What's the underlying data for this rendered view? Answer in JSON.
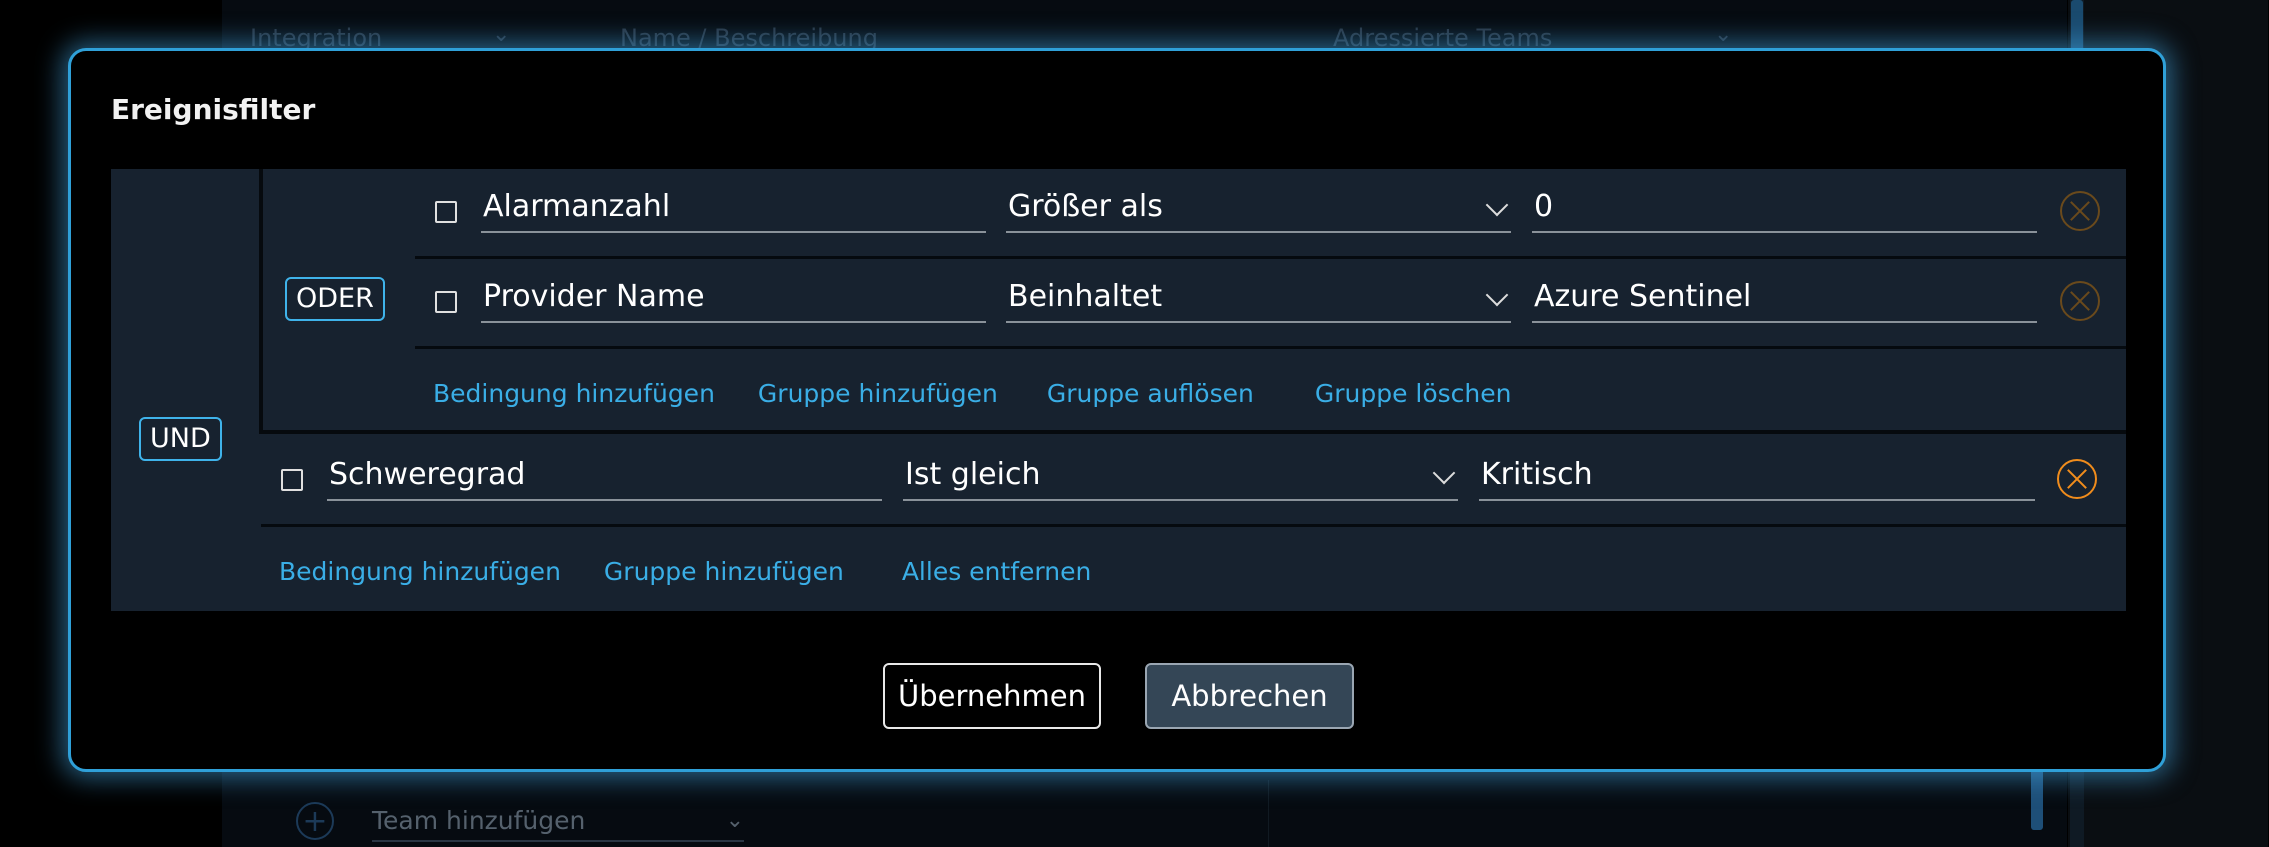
{
  "background": {
    "columns": [
      {
        "label": "Integration"
      },
      {
        "label": "Name / Beschreibung"
      },
      {
        "label": "Adressierte Teams"
      }
    ],
    "team_select_placeholder": "Team hinzufügen"
  },
  "dialog": {
    "title": "Ereignisfilter",
    "root_operator": "UND",
    "group_operator": "ODER",
    "group_conditions": [
      {
        "field": "Alarmanzahl",
        "operator": "Größer als",
        "value": "0"
      },
      {
        "field": "Provider Name",
        "operator": "Beinhaltet",
        "value": "Azure Sentinel"
      }
    ],
    "group_actions": {
      "add_condition": "Bedingung hinzufügen",
      "add_group": "Gruppe hinzufügen",
      "ungroup": "Gruppe auflösen",
      "delete_group": "Gruppe löschen"
    },
    "root_conditions": [
      {
        "field": "Schweregrad",
        "operator": "Ist gleich",
        "value": "Kritisch"
      }
    ],
    "root_actions": {
      "add_condition": "Bedingung hinzufügen",
      "add_group": "Gruppe hinzufügen",
      "remove_all": "Alles entfernen"
    },
    "buttons": {
      "apply": "Übernehmen",
      "cancel": "Abbrechen"
    },
    "colors": {
      "accent": "#3aaee6",
      "remove_active": "#f08c1c",
      "panel_bg": "#17222f",
      "modal_border": "#2fa0d8"
    }
  }
}
